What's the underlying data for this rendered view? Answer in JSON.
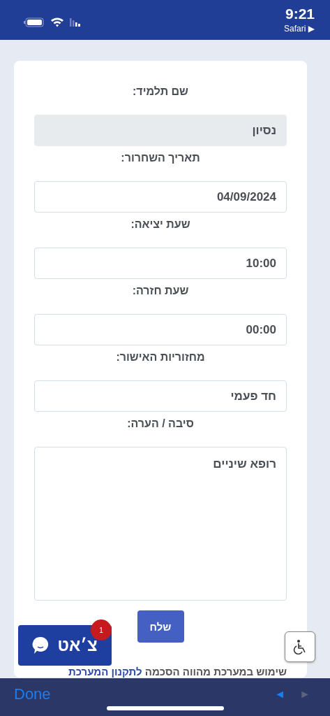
{
  "status_bar": {
    "time": "9:21",
    "back_app": "Safari ▶"
  },
  "form": {
    "fields": [
      {
        "label": "שם תלמיד:",
        "value": "נסיון",
        "kind": "input",
        "disabled": true
      },
      {
        "label": "תאריך השחרור:",
        "value": "04/09/2024",
        "kind": "input",
        "disabled": false
      },
      {
        "label": "שעת יציאה:",
        "value": "10:00",
        "kind": "input",
        "disabled": false
      },
      {
        "label": "שעת חזרה:",
        "value": "00:00",
        "kind": "input",
        "disabled": false
      },
      {
        "label": "מחזוריות האישור:",
        "value": "חד פעמי",
        "kind": "input",
        "disabled": false
      },
      {
        "label": "סיבה / הערה:",
        "value": "רופא שיניים",
        "kind": "textarea",
        "disabled": false
      }
    ],
    "submit": "שלח",
    "footer": {
      "text": "שימוש במערכת מהווה הסכמה ",
      "link": "לתקנון המערכת"
    }
  },
  "chat_button": {
    "label": "צ׳אט",
    "badge": "1"
  },
  "browser_bar": {
    "done": "Done",
    "back": {
      "label": "◄",
      "disabled": false
    },
    "forward": {
      "label": "►",
      "disabled": true
    }
  }
}
